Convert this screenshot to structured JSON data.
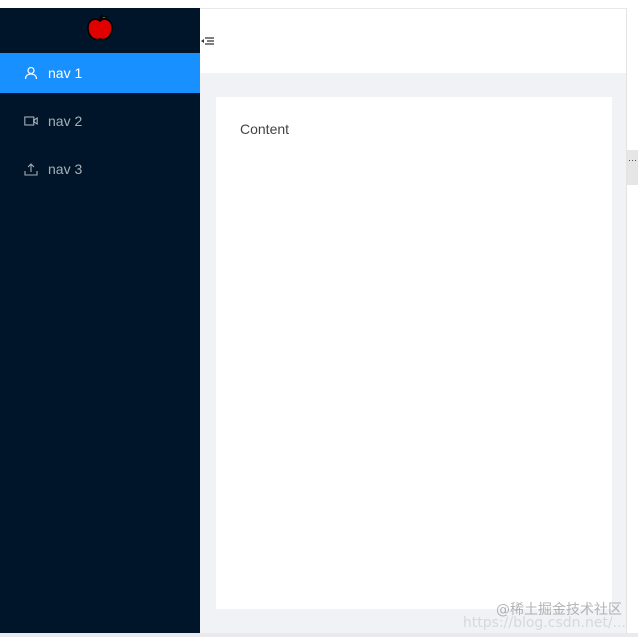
{
  "sidebar": {
    "logo_icon": "apple-icon",
    "items": [
      {
        "label": "nav 1",
        "icon": "user-icon",
        "active": true
      },
      {
        "label": "nav 2",
        "icon": "video-camera-icon",
        "active": false
      },
      {
        "label": "nav 3",
        "icon": "upload-icon",
        "active": false
      }
    ]
  },
  "header": {
    "trigger_icon": "menu-fold-icon"
  },
  "main": {
    "content_text": "Content"
  },
  "watermark": {
    "text": "@稀土掘金技术社区",
    "url_text": "https://blog.csdn.net/..."
  },
  "colors": {
    "sider_bg": "#001529",
    "active_item_bg": "#1890ff",
    "layout_bg": "#f0f2f5"
  }
}
